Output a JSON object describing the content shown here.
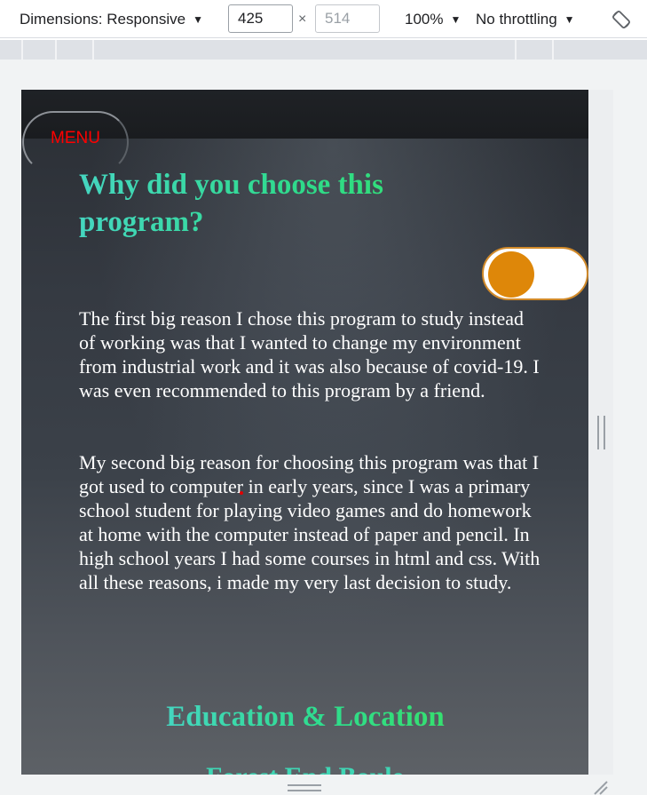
{
  "toolbar": {
    "dimensions_label": "Dimensions: Responsive",
    "width_value": "425",
    "times_sign": "×",
    "height_placeholder": "514",
    "zoom_label": "100%",
    "throttling_label": "No throttling",
    "rotate_icon": "rotate-icon"
  },
  "page": {
    "menu_label": "MENU",
    "heading": "Why did you choose this program?",
    "theme_toggle": {
      "state": "off",
      "knob_color": "#de8709"
    },
    "paragraphs": [
      "The first big reason I chose this program to study instead of working was that I wanted to change my environment from industrial work and it was also because of covid-19. I was even recommended to this program by a friend.",
      "My second big reason for choosing this program was that I got used to computer in early years, since I was a primary school student for playing video games and do homework at home with the computer instead of paper and pencil. In high school years I had some courses in html and css. With all these reasons, i made my very last decision to study."
    ],
    "section_title": "Education & Location",
    "sub_title": "Forest End Boule"
  },
  "colors": {
    "accent_green": "#35e070",
    "accent_teal": "#45d6c0",
    "menu_red": "#ff0000",
    "toggle_orange": "#de8709"
  }
}
